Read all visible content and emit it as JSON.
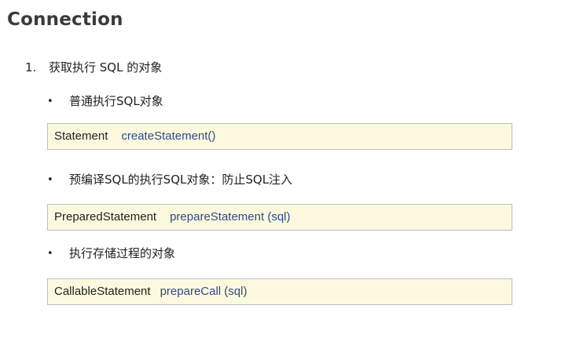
{
  "title": "Connection",
  "item1": {
    "number": "1.",
    "text": "获取执行 SQL 的对象"
  },
  "bullets": [
    {
      "marker": "•",
      "text": "普通执行SQL对象",
      "code": {
        "type": "Statement",
        "method": "createStatement()"
      }
    },
    {
      "marker": "•",
      "text": "预编译SQL的执行SQL对象：防止SQL注入",
      "code": {
        "type": "PreparedStatement",
        "method": "prepareStatement (sql)"
      }
    },
    {
      "marker": "•",
      "text": "执行存储过程的对象",
      "code": {
        "type": "CallableStatement",
        "method": "prepareCall (sql)"
      }
    }
  ],
  "colors": {
    "code_bg": "#fdf9df",
    "code_border": "#bdbdbd",
    "method_text": "#2e4a8a"
  }
}
